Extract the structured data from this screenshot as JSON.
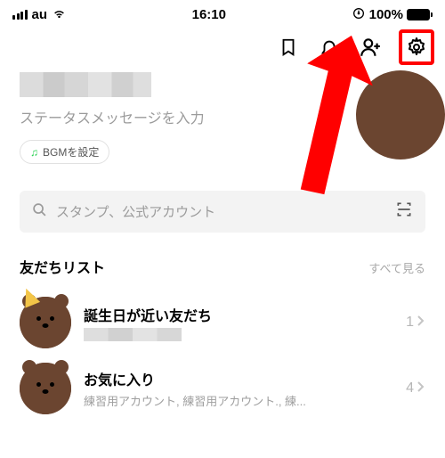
{
  "statusbar": {
    "carrier": "au",
    "time": "16:10",
    "battery_pct": "100%"
  },
  "profile": {
    "status_placeholder": "ステータスメッセージを入力",
    "bgm_label": "BGMを設定"
  },
  "search": {
    "placeholder": "スタンプ、公式アカウント"
  },
  "friends": {
    "section_title": "友だちリスト",
    "see_all": "すべて見る",
    "items": [
      {
        "title": "誕生日が近い友だち",
        "subtitle": "",
        "count": "1"
      },
      {
        "title": "お気に入り",
        "subtitle": "練習用アカウント, 練習用アカウント., 練...",
        "count": "4"
      }
    ]
  }
}
